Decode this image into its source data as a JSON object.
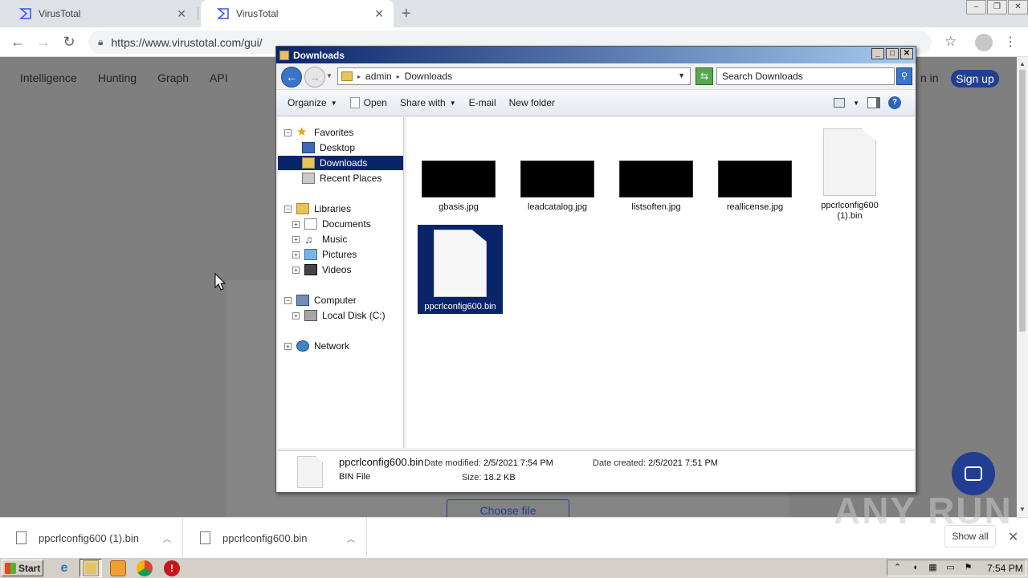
{
  "browser": {
    "tabs": [
      {
        "title": "VirusTotal",
        "active": false
      },
      {
        "title": "VirusTotal",
        "active": true
      }
    ],
    "url": "https://www.virustotal.com/gui/"
  },
  "page": {
    "nav": [
      "Intelligence",
      "Hunting",
      "Graph",
      "API"
    ],
    "signin_partial": "n in",
    "signup": "Sign up",
    "choose_file": "Choose file"
  },
  "explorer": {
    "title": "Downloads",
    "breadcrumb": [
      "admin",
      "Downloads"
    ],
    "search_placeholder": "Search Downloads",
    "commands": {
      "organize": "Organize",
      "open": "Open",
      "share_with": "Share with",
      "email": "E-mail",
      "new_folder": "New folder"
    },
    "tree": {
      "favorites": "Favorites",
      "desktop": "Desktop",
      "downloads": "Downloads",
      "recent_places": "Recent Places",
      "libraries": "Libraries",
      "documents": "Documents",
      "music": "Music",
      "pictures": "Pictures",
      "videos": "Videos",
      "computer": "Computer",
      "local_disk": "Local Disk (C:)",
      "network": "Network"
    },
    "files": [
      {
        "name": "gbasis.jpg",
        "kind": "image"
      },
      {
        "name": "leadcatalog.jpg",
        "kind": "image"
      },
      {
        "name": "listsoften.jpg",
        "kind": "image"
      },
      {
        "name": "reallicense.jpg",
        "kind": "image"
      },
      {
        "name": "ppcrlconfig600 (1).bin",
        "kind": "document"
      },
      {
        "name": "ppcrlconfig600.bin",
        "kind": "document",
        "selected": true
      }
    ],
    "details": {
      "name": "ppcrlconfig600.bin",
      "type": "BIN File",
      "date_modified_label": "Date modified:",
      "date_modified": "2/5/2021 7:54 PM",
      "date_created_label": "Date created:",
      "date_created": "2/5/2021 7:51 PM",
      "size_label": "Size:",
      "size": "18.2 KB"
    }
  },
  "downloads_shelf": {
    "items": [
      "ppcrlconfig600 (1).bin",
      "ppcrlconfig600.bin"
    ],
    "show_all": "Show all"
  },
  "watermark": "ANY RUN",
  "taskbar": {
    "start": "Start",
    "clock": "7:54 PM"
  }
}
